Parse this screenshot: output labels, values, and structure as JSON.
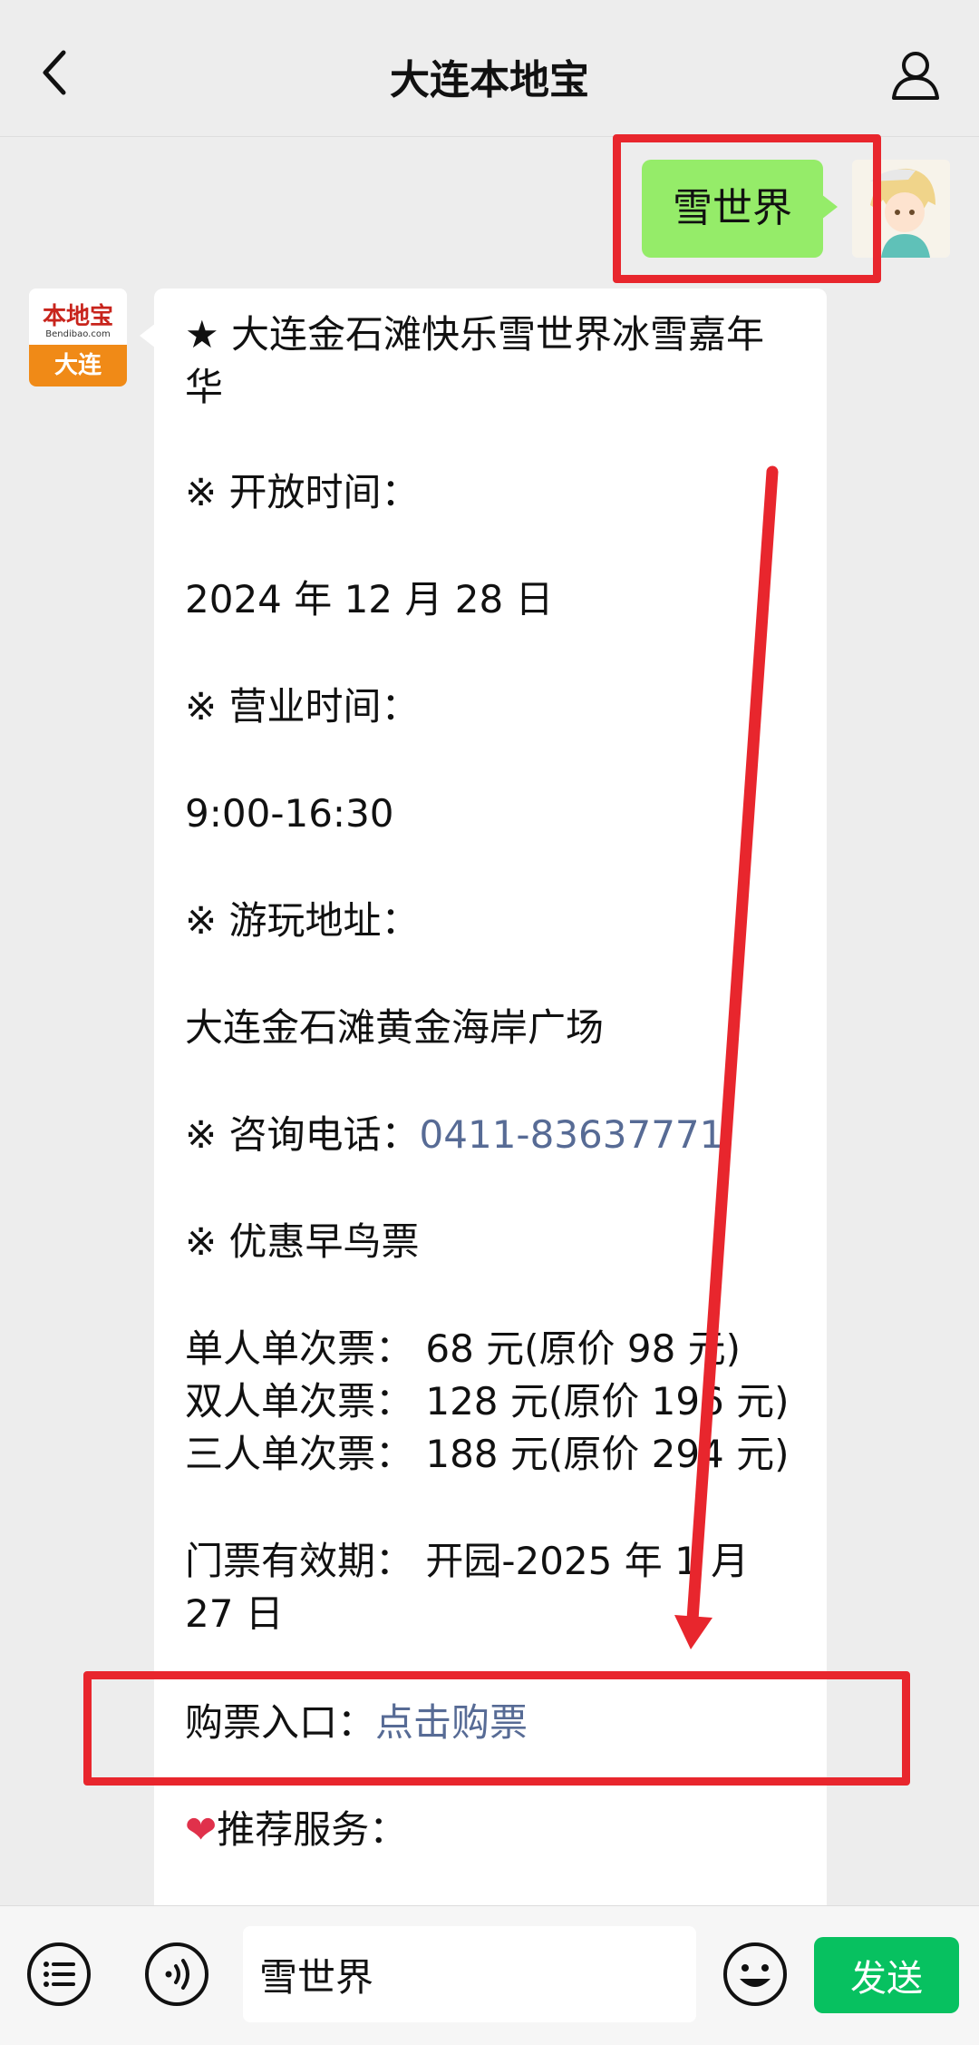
{
  "header": {
    "title": "大连本地宝"
  },
  "user_message": {
    "text": "雪世界"
  },
  "bot_avatar": {
    "logo": "本地宝",
    "logo_sub": "Bendibao.com",
    "city": "大连"
  },
  "message": {
    "title": "★ 大连金石滩快乐雪世界冰雪嘉年华",
    "open_label": "※ 开放时间：",
    "open_date": "2024 年 12 月 28 日",
    "hours_label": "※ 营业时间：",
    "hours": "9:00-16:30",
    "address_label": "※ 游玩地址：",
    "address": "大连金石滩黄金海岸广场",
    "phone_label": "※ 咨询电话：",
    "phone": "0411-83637771",
    "early_bird_label": "※ 优惠早鸟票",
    "ticket_single": "单人单次票：  68 元(原价 98 元)",
    "ticket_double": "双人单次票：  128 元(原价 196 元)",
    "ticket_triple": "三人单次票：  188 元(原价 294 元)",
    "validity": "门票有效期：  开园-2025 年 1 月 27 日",
    "buy_label": "购票入口：",
    "buy_link": "点击购票",
    "recommend": "推荐服务："
  },
  "input_bar": {
    "value": "雪世界",
    "send_label": "发送"
  },
  "colors": {
    "accent_green": "#07c160",
    "bubble_green": "#95ec69",
    "link": "#576b95",
    "annotation_red": "#e8262d"
  }
}
